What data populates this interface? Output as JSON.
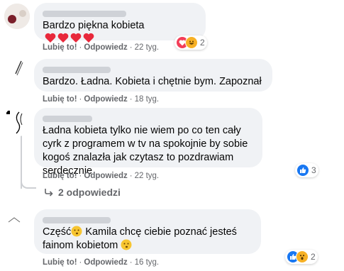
{
  "comments": [
    {
      "text": "Bardzo piękna kobieta",
      "actions": {
        "like": "Lubię to!",
        "reply": "Odpowiedz",
        "time": "22 tyg."
      },
      "reactions": {
        "icons": [
          "love-icon",
          "laugh-icon"
        ],
        "count": "2"
      }
    },
    {
      "text": "Bardzo. Ładna. Kobieta i chętnie bym. Zapoznał",
      "actions": {
        "like": "Lubię to!",
        "reply": "Odpowiedz",
        "time": "18 tyg."
      }
    },
    {
      "text": "Ładna kobieta tylko nie wiem po co ten cały cyrk z programem w tv na spokojnie by sobie kogoś znalazła jak czytasz to pozdrawiam serdecznie",
      "actions": {
        "like": "Lubię to!",
        "reply": "Odpowiedz",
        "time": "22 tyg."
      },
      "reactions": {
        "icons": [
          "like-icon"
        ],
        "count": "3"
      },
      "replies": "2 odpowiedzi"
    },
    {
      "text_before": "Część",
      "text_mid": " Kamila chcę ciebie poznać jesteś fainom kobietom ",
      "actions": {
        "like": "Lubię to!",
        "reply": "Odpowiedz",
        "time": "16 tyg."
      },
      "reactions": {
        "icons": [
          "like-icon",
          "wow-icon"
        ],
        "count": "2"
      }
    }
  ],
  "colors": {
    "bubble": "#f0f2f5",
    "meta_text": "#65676b",
    "like_blue": "#1877f2",
    "love_red": "#f33e58",
    "haha_yellow": "#f7b125"
  }
}
